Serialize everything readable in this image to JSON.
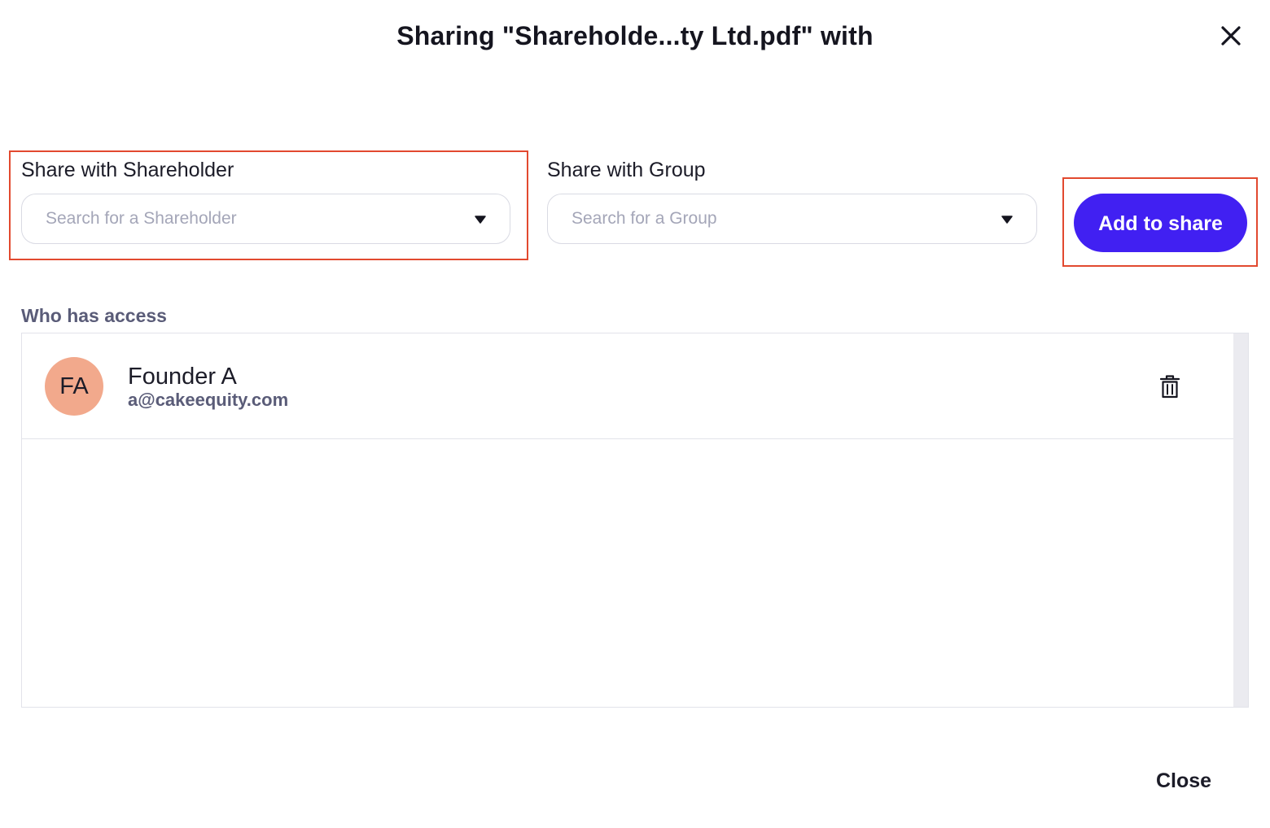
{
  "dialog": {
    "title": "Sharing \"Shareholde...ty Ltd.pdf\" with",
    "close_icon": "close-icon"
  },
  "shareholder_field": {
    "label": "Share with Shareholder",
    "placeholder": "Search for a Shareholder",
    "caret_icon": "caret-down-icon"
  },
  "group_field": {
    "label": "Share with Group",
    "placeholder": "Search for a Group",
    "caret_icon": "caret-down-icon"
  },
  "add_button": {
    "label": "Add to share"
  },
  "access": {
    "heading": "Who has access",
    "people": [
      {
        "initials": "FA",
        "name": "Founder A",
        "email": "a@cakeequity.com",
        "avatar_color": "#f2a98c",
        "remove_icon": "trash-icon"
      }
    ]
  },
  "footer": {
    "close_label": "Close"
  },
  "colors": {
    "primary": "#4120f2",
    "highlight": "#e2492f",
    "muted_text": "#5a5c78",
    "placeholder_text": "#a4a6b8"
  }
}
